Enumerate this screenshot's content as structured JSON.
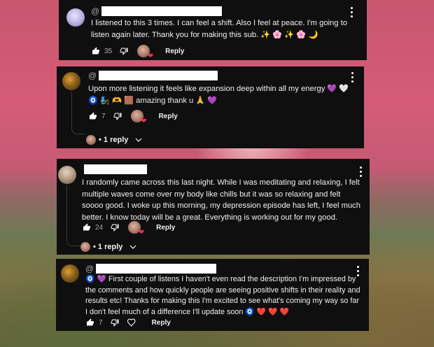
{
  "comments": [
    {
      "handle_prefix": "@",
      "text": "I listened to this 3 times. I can feel a shift. Also I feel at peace. I'm going to listen again later.  Thank you for making this sub. ✨ 🌸 ✨ 🌸 🌙",
      "likes": "35",
      "reply_label": "Reply",
      "avatar_color": "#c9c2e8"
    },
    {
      "handle_prefix": "@",
      "text": "Upon more listening it feels like expansion deep within all my energy 💜 🤍 🧿 🧞 🫶 🟫 amazing thank u 🙏 💜",
      "likes": "7",
      "reply_label": "Reply",
      "thread_label": "• 1 reply",
      "avatar_color": "#8a6a2a"
    },
    {
      "handle_prefix": "",
      "text": "I randomly came across this last night. While I was meditating and relaxing, I felt multiple waves come over my body like chills but it was so relaxing and felt soooo good. I woke up this morning, my depression episode has left, I feel much better. I know today will be a great. Everything is working out for my good.",
      "likes": "24",
      "reply_label": "Reply",
      "thread_label": "• 1 reply",
      "avatar_color": "#b9a48a"
    },
    {
      "handle_prefix": "@",
      "text": "🧿 💜 First couple of listens I haven't even read the description I'm impressed by the comments and how quickly people are seeing positive shifts in their reality and results etc! Thanks for making this I'm excited to see what's coming my way so far I don't feel much of a difference I'll update soon 🧿 ❤️ ❤️ ❤️",
      "likes": "7",
      "reply_label": "Reply",
      "avatar_color": "#8a6a2a"
    }
  ],
  "colors": {
    "card_bg": "#0f0f0f",
    "text": "#f1f1f1",
    "muted": "#aaaaaa",
    "heart": "#ff2b4a"
  },
  "icons": [
    "thumb-up-icon",
    "thumb-down-icon",
    "heart-icon",
    "more-vert-icon"
  ]
}
